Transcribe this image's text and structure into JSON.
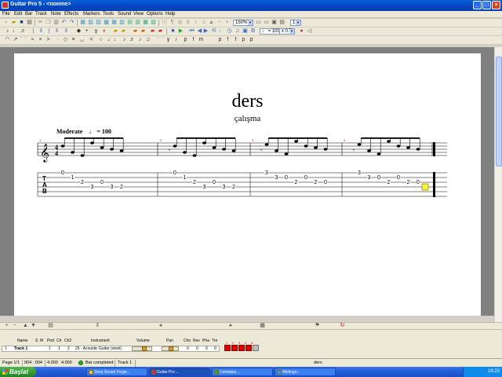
{
  "window": {
    "title": "Guitar Pro 5 - <nonme>",
    "controls": [
      "_",
      "□",
      "×"
    ]
  },
  "menu": [
    "File",
    "Edit",
    "Bar",
    "Track",
    "Note",
    "Effects",
    "Markers",
    "Tools",
    "Sound",
    "View",
    "Options",
    "Help"
  ],
  "toolbar": {
    "zoom": "150%",
    "tempo_label": "♩ = 100",
    "speed_label": "x 0.5"
  },
  "score": {
    "title": "ders",
    "subtitle": "çalışma",
    "tempo_word": "Moderate",
    "tempo_mark": "♩ = 100",
    "time_signature_top": "4",
    "time_signature_bottom": "4",
    "tab_label": [
      "T",
      "A",
      "B"
    ],
    "bar_numbers": [
      "1",
      "2",
      "3",
      "4"
    ],
    "bars": [
      {
        "notes": [
          {
            "fret": "0",
            "string": 1
          },
          {
            "fret": "1",
            "string": 2
          },
          {
            "fret": "2",
            "string": 3
          },
          {
            "fret": "3",
            "string": 4
          },
          {
            "fret": "0",
            "string": 3
          },
          {
            "fret": "3",
            "string": 4
          },
          {
            "fret": "2",
            "string": 4
          }
        ]
      },
      {
        "notes": [
          {
            "fret": "0",
            "string": 1
          },
          {
            "fret": "1",
            "string": 2
          },
          {
            "fret": "2",
            "string": 3
          },
          {
            "fret": "3",
            "string": 4
          },
          {
            "fret": "0",
            "string": 3
          },
          {
            "fret": "3",
            "string": 4
          },
          {
            "fret": "2",
            "string": 4
          }
        ]
      },
      {
        "notes": [
          {
            "fret": "3",
            "string": 1
          },
          {
            "fret": "3",
            "string": 2
          },
          {
            "fret": "0",
            "string": 2
          },
          {
            "fret": "2",
            "string": 3
          },
          {
            "fret": "0",
            "string": 2
          },
          {
            "fret": "2",
            "string": 3
          },
          {
            "fret": "0",
            "string": 3
          }
        ]
      },
      {
        "notes": [
          {
            "fret": "3",
            "string": 1
          },
          {
            "fret": "3",
            "string": 2
          },
          {
            "fret": "0",
            "string": 2
          },
          {
            "fret": "2",
            "string": 3
          },
          {
            "fret": "0",
            "string": 2
          },
          {
            "fret": "2",
            "string": 3
          },
          {
            "fret": "0",
            "string": 3
          }
        ]
      }
    ]
  },
  "tracks": {
    "headers": [
      "Name",
      "S",
      "M",
      "Port",
      "Ch",
      "Ch2",
      "Instrument",
      "Volume",
      "Pan",
      "Cho",
      "Rev",
      "Pha",
      "Tre"
    ],
    "rows": [
      {
        "num": "1",
        "name": "Track 1",
        "port": "1",
        "ch": "1",
        "ch2": "2",
        "instrument": "25 - Acoustic Guitar (steel)",
        "cho": "0",
        "rev": "0",
        "pha": "0",
        "tre": "0",
        "volume": 0.6,
        "pan": 0.5
      }
    ],
    "bar_numbers": [
      "1",
      "2",
      "3",
      "4",
      "5"
    ]
  },
  "status": {
    "page": "Page 1/1",
    "position": "004 : 004",
    "time1": "4.000",
    "time2": "4.000",
    "message": "Bar completed",
    "track": "Track 1",
    "song": "ders"
  },
  "taskbar": {
    "start_label": "Başlat",
    "tasks": [
      "Sony Sound Forge...",
      "Guitar Pro ...",
      "Camtasia...",
      "Ntekngo..."
    ],
    "clock": "19:23"
  },
  "colors": {
    "title_bar": "#0a5fd8",
    "cursor_highlight": "#f5f53c",
    "bar_cell": "#e00000"
  }
}
